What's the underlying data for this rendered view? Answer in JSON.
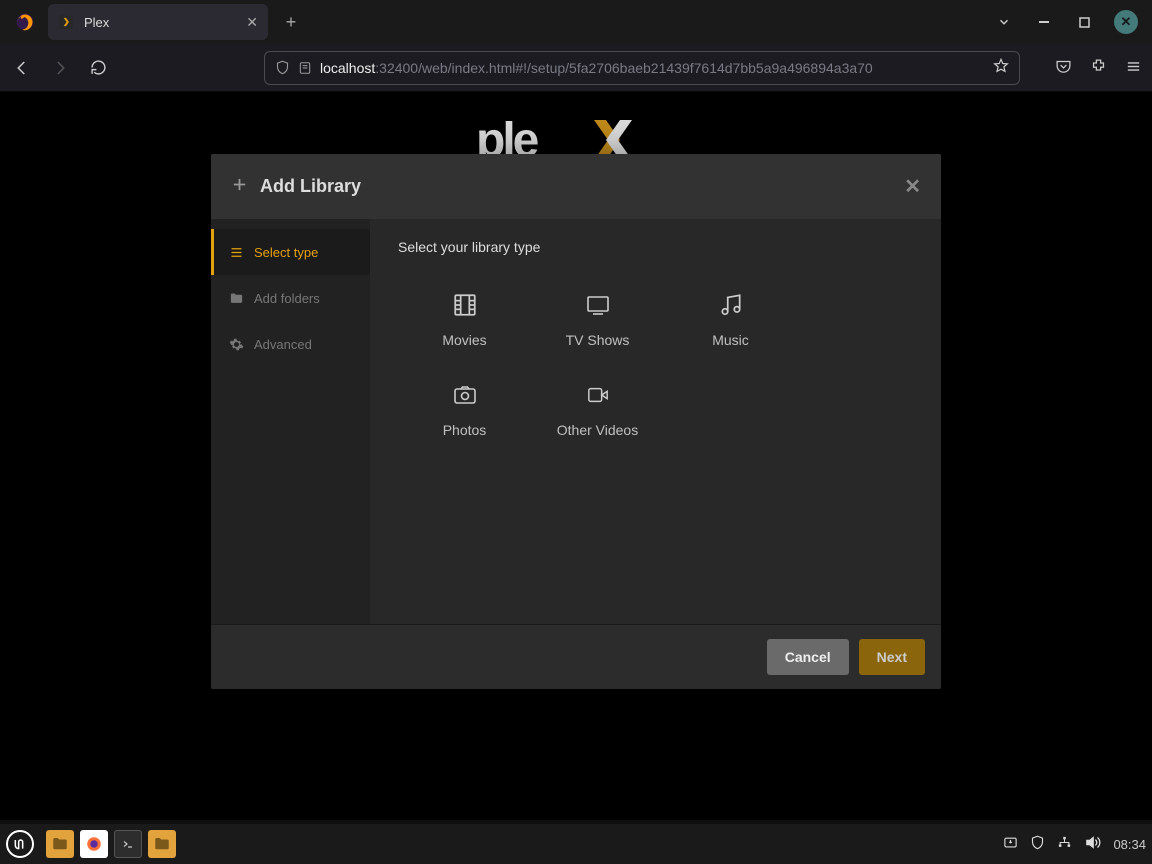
{
  "browser": {
    "tab_title": "Plex",
    "url_host": "localhost",
    "url_path": ":32400/web/index.html#!/setup/5fa2706baeb21439f7614d7bb5a9a496894a3a70"
  },
  "modal": {
    "title": "Add Library",
    "steps": [
      {
        "label": "Select type",
        "active": true
      },
      {
        "label": "Add folders",
        "active": false
      },
      {
        "label": "Advanced",
        "active": false
      }
    ],
    "content_title": "Select your library type",
    "types": [
      {
        "label": "Movies"
      },
      {
        "label": "TV Shows"
      },
      {
        "label": "Music"
      },
      {
        "label": "Photos"
      },
      {
        "label": "Other Videos"
      }
    ],
    "cancel": "Cancel",
    "next": "Next"
  },
  "panel": {
    "clock": "08:34"
  }
}
